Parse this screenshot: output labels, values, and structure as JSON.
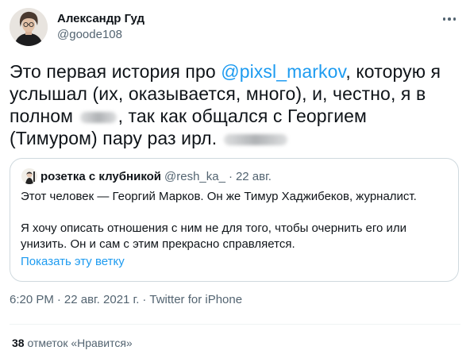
{
  "author": {
    "name": "Александр Гуд",
    "handle": "@goode108"
  },
  "tweet": {
    "text_part1": "Это первая история про ",
    "mention": "@pixsl_markov",
    "text_part2": ", которую я услышал (их, оказывается, много), и, честно, я в полном ",
    "text_part3": ", так как общался с Георгием (Тимуром) пару раз ирл. "
  },
  "quote": {
    "author_name": "розетка с клубникой",
    "author_handle": "@resh_ka_",
    "separator": "·",
    "date": "22 авг.",
    "paragraph1": "Этот человек — Георгий Марков. Он же Тимур Хаджибеков, журналист.",
    "paragraph2": "Я хочу описать отношения с ним не для того, чтобы очернить его или унизить. Он и сам с этим прекрасно справляется.",
    "show_thread_label": "Показать эту ветку"
  },
  "meta": {
    "time": "6:20 PM",
    "separator": "·",
    "date": "22 авг. 2021 г.",
    "source": "Twitter for iPhone"
  },
  "likes": {
    "count": "38",
    "label": " отметок «Нравится»"
  },
  "colors": {
    "link": "#1d9bf0",
    "text": "#0f1419",
    "secondary": "#536471",
    "border": "#cfd9de"
  }
}
